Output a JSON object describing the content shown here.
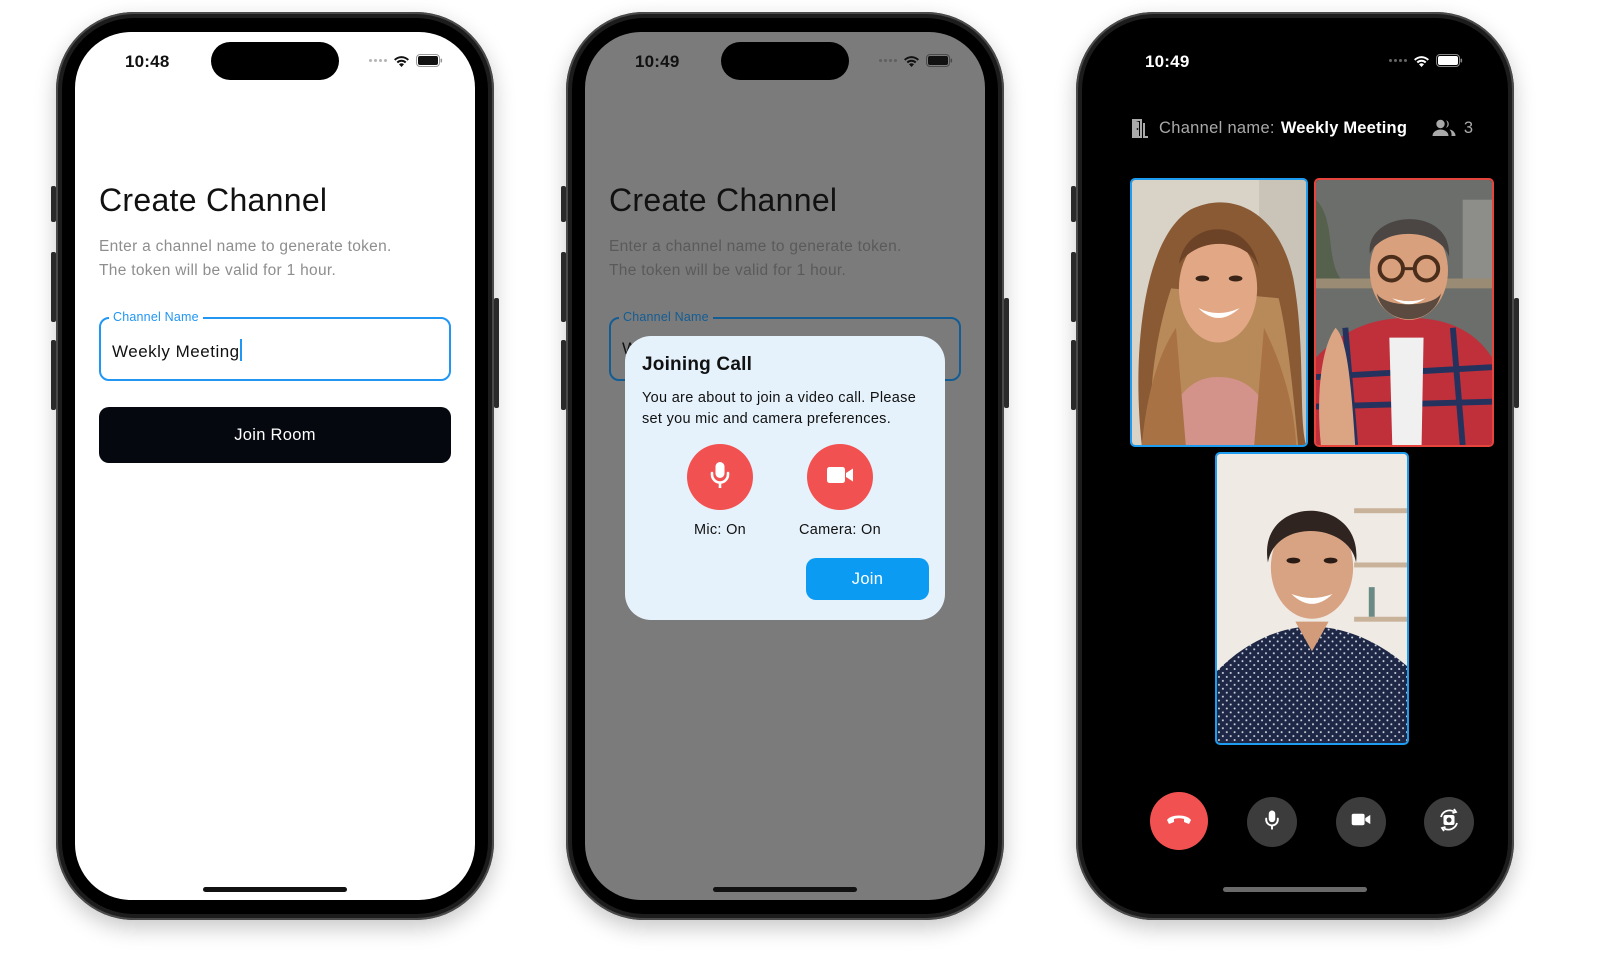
{
  "phones": [
    {
      "status": {
        "time": "10:48"
      },
      "screen": {
        "title": "Create Channel",
        "subtitle_line1": "Enter a channel name to generate token.",
        "subtitle_line2": "The token will be valid for 1 hour.",
        "channel_field": {
          "label": "Channel Name",
          "value": "Weekly Meeting"
        },
        "join_room_label": "Join Room"
      }
    },
    {
      "status": {
        "time": "10:49"
      },
      "screen": {
        "title": "Create Channel",
        "subtitle_line1": "Enter a channel name to generate token.",
        "subtitle_line2": "The token will be valid for 1 hour.",
        "channel_field": {
          "label": "Channel Name",
          "value": "Weekly Meeting"
        }
      },
      "dialog": {
        "title": "Joining Call",
        "body": "You are about to join a video call. Please set you mic and camera preferences.",
        "mic_label": "Mic: On",
        "camera_label": "Camera: On",
        "join_label": "Join"
      }
    },
    {
      "status": {
        "time": "10:49"
      },
      "call": {
        "channel_label": "Channel name:",
        "channel_name": "Weekly Meeting",
        "participant_count": "3",
        "tiles": [
          {
            "participant": "woman-long-hair",
            "active_speaker": false
          },
          {
            "participant": "man-glasses",
            "active_speaker": true
          },
          {
            "participant": "woman-polka-dot",
            "active_speaker": false
          }
        ],
        "controls": [
          "end-call",
          "microphone",
          "camera",
          "switch-camera"
        ]
      }
    }
  ],
  "colors": {
    "accent_blue": "#2196f3",
    "join_blue": "#0c9bf2",
    "danger_red": "#f25151",
    "active_speaker_red": "#e5453c",
    "dark_button": "#05080e",
    "dialog_bg": "#e6f2fb",
    "scrim_gray": "#7b7b7b"
  }
}
